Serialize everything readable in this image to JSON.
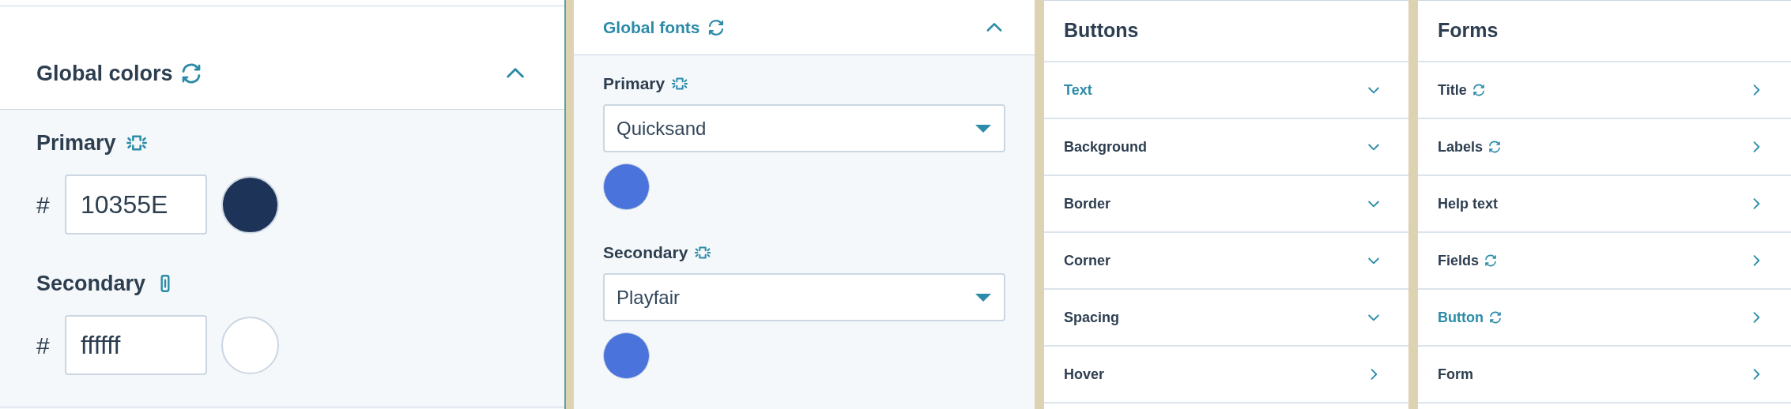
{
  "global_colors": {
    "title": "Global colors",
    "expanded": true,
    "colors": [
      {
        "label": "Primary",
        "linked": false,
        "hash": "#",
        "value": "10355E",
        "color": "#1e3358"
      },
      {
        "label": "Secondary",
        "linked": true,
        "hash": "#",
        "value": "ffffff",
        "color": "#ffffff"
      }
    ]
  },
  "global_fonts": {
    "title": "Global fonts",
    "expanded": true,
    "fonts": [
      {
        "label": "Primary",
        "linked": false,
        "value": "Quicksand",
        "color": "#4a74dc"
      },
      {
        "label": "Secondary",
        "linked": false,
        "value": "Playfair",
        "color": "#4a74dc"
      }
    ]
  },
  "buttons": {
    "title": "Buttons",
    "items": [
      {
        "label": "Text",
        "kind": "dropdown",
        "selected": true,
        "synced": false
      },
      {
        "label": "Background",
        "kind": "dropdown",
        "selected": false,
        "synced": false
      },
      {
        "label": "Border",
        "kind": "dropdown",
        "selected": false,
        "synced": false
      },
      {
        "label": "Corner",
        "kind": "dropdown",
        "selected": false,
        "synced": false
      },
      {
        "label": "Spacing",
        "kind": "dropdown",
        "selected": false,
        "synced": false
      },
      {
        "label": "Hover",
        "kind": "link",
        "selected": false,
        "synced": false
      }
    ]
  },
  "forms": {
    "title": "Forms",
    "items": [
      {
        "label": "Title",
        "kind": "link",
        "selected": false,
        "synced": true
      },
      {
        "label": "Labels",
        "kind": "link",
        "selected": false,
        "synced": true
      },
      {
        "label": "Help text",
        "kind": "link",
        "selected": false,
        "synced": false
      },
      {
        "label": "Fields",
        "kind": "link",
        "selected": false,
        "synced": true
      },
      {
        "label": "Button",
        "kind": "link",
        "selected": true,
        "synced": true
      },
      {
        "label": "Form",
        "kind": "link",
        "selected": false,
        "synced": false
      }
    ]
  }
}
